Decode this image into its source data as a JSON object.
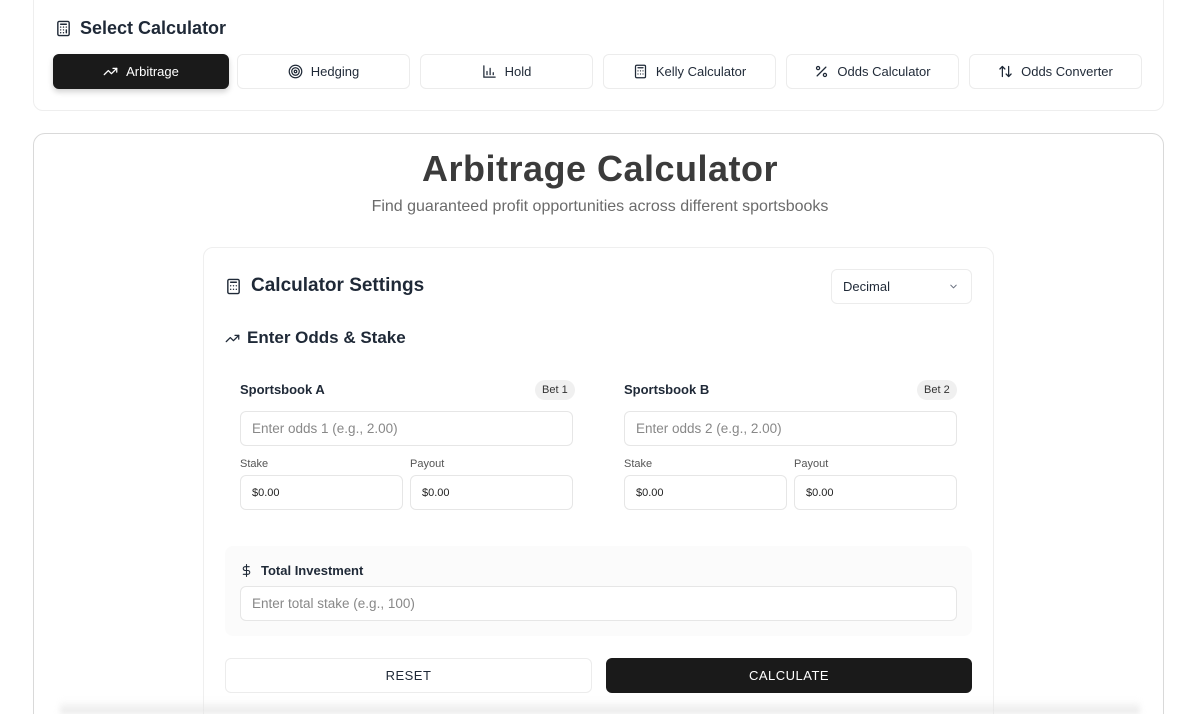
{
  "selector": {
    "title": "Select Calculator",
    "tabs": [
      {
        "label": "Arbitrage",
        "icon": "trending-up-icon",
        "active": true
      },
      {
        "label": "Hedging",
        "icon": "target-icon",
        "active": false
      },
      {
        "label": "Hold",
        "icon": "bar-chart-icon",
        "active": false
      },
      {
        "label": "Kelly Calculator",
        "icon": "calculator-icon",
        "active": false
      },
      {
        "label": "Odds Calculator",
        "icon": "percent-icon",
        "active": false
      },
      {
        "label": "Odds Converter",
        "icon": "arrow-up-down-icon",
        "active": false
      }
    ]
  },
  "header": {
    "title": "Arbitrage Calculator",
    "subtitle": "Find guaranteed profit opportunities across different sportsbooks"
  },
  "settings": {
    "title": "Calculator Settings",
    "odds_format": "Decimal",
    "section_title": "Enter Odds & Stake"
  },
  "bets": [
    {
      "sportsbook": "Sportsbook A",
      "badge": "Bet 1",
      "odds_placeholder": "Enter odds 1 (e.g., 2.00)",
      "stake_label": "Stake",
      "stake_value": "$0.00",
      "payout_label": "Payout",
      "payout_value": "$0.00"
    },
    {
      "sportsbook": "Sportsbook B",
      "badge": "Bet 2",
      "odds_placeholder": "Enter odds 2 (e.g., 2.00)",
      "stake_label": "Stake",
      "stake_value": "$0.00",
      "payout_label": "Payout",
      "payout_value": "$0.00"
    }
  ],
  "investment": {
    "title": "Total Investment",
    "placeholder": "Enter total stake (e.g., 100)"
  },
  "actions": {
    "reset_label": "RESET",
    "calculate_label": "CALCULATE"
  },
  "colors": {
    "primary": "#1a1a1a",
    "border": "#e6e6e6",
    "muted_text": "#6b6b6b"
  }
}
